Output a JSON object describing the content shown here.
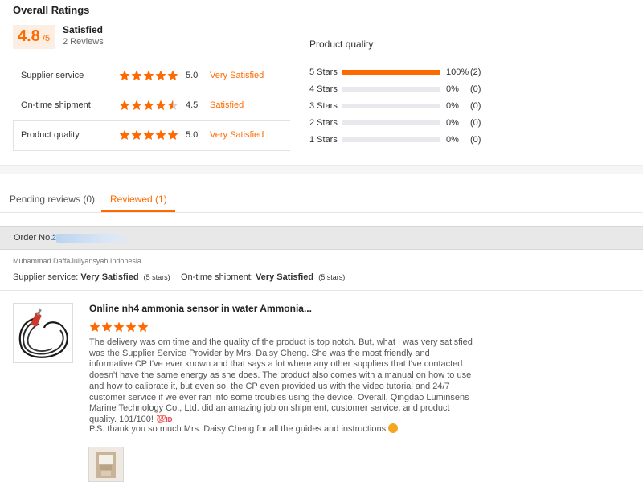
{
  "overall": {
    "title": "Overall Ratings",
    "score": "4.8",
    "score_suffix": "/5",
    "summary": "Satisfied",
    "review_count": "2 Reviews"
  },
  "categories": [
    {
      "label": "Supplier service",
      "rating": 5.0,
      "score": "5.0",
      "text": "Very Satisfied"
    },
    {
      "label": "On-time shipment",
      "rating": 4.5,
      "score": "4.5",
      "text": "Satisfied"
    },
    {
      "label": "Product quality",
      "rating": 5.0,
      "score": "5.0",
      "text": "Very Satisfied"
    }
  ],
  "distribution": {
    "title": "Product quality",
    "rows": [
      {
        "label": "5 Stars",
        "fraction": 1.0,
        "pct": "100%",
        "count": "(2)"
      },
      {
        "label": "4 Stars",
        "fraction": 0,
        "pct": "0%",
        "count": "(0)"
      },
      {
        "label": "3 Stars",
        "fraction": 0,
        "pct": "0%",
        "count": "(0)"
      },
      {
        "label": "2 Stars",
        "fraction": 0,
        "pct": "0%",
        "count": "(0)"
      },
      {
        "label": "1 Stars",
        "fraction": 0,
        "pct": "0%",
        "count": "(0)"
      }
    ]
  },
  "tabs": {
    "pending": "Pending reviews (0)",
    "reviewed": "Reviewed (1)"
  },
  "order": {
    "label": "Order No.:",
    "number_visible": "2"
  },
  "review": {
    "buyer": "Muhammad DaffaJuliyansyah,Indonesia",
    "supplier_service_label": "Supplier service:",
    "supplier_service_value": "Very Satisfied",
    "supplier_service_stars": "(5 stars)",
    "ontime_label": "On-time shipment:",
    "ontime_value": "Very Satisfied",
    "ontime_stars": "(5 stars)",
    "product_title": "Online nh4 ammonia sensor in water Ammonia...",
    "rating": 5,
    "body": "The delivery was om time and the quality of the product is top notch. But, what I was very satisfied was the Supplier Service Provider by Mrs. Daisy Cheng. She was the most friendly and informative CP I've ever known and that says a lot where any other suppliers that I've contacted doesn't have the same energy as she does. The product also comes with a manual on how to use and how to calibrate it, but even so, the CP even provided us with the video tutorial and 24/7 customer service if we ever ran into some troubles using the device. Overall, Qingdao Luminsens Marine Technology Co., Ltd. did an amazing job on shipment, customer service, and product quality. 101/100!",
    "body_emoji_text": "ID",
    "ps": "P.S. thank you so much Mrs. Daisy Cheng for all the guides and instructions"
  },
  "colors": {
    "accent": "#ff6a00",
    "link": "#4a90d9",
    "track": "#e8e8ee"
  }
}
